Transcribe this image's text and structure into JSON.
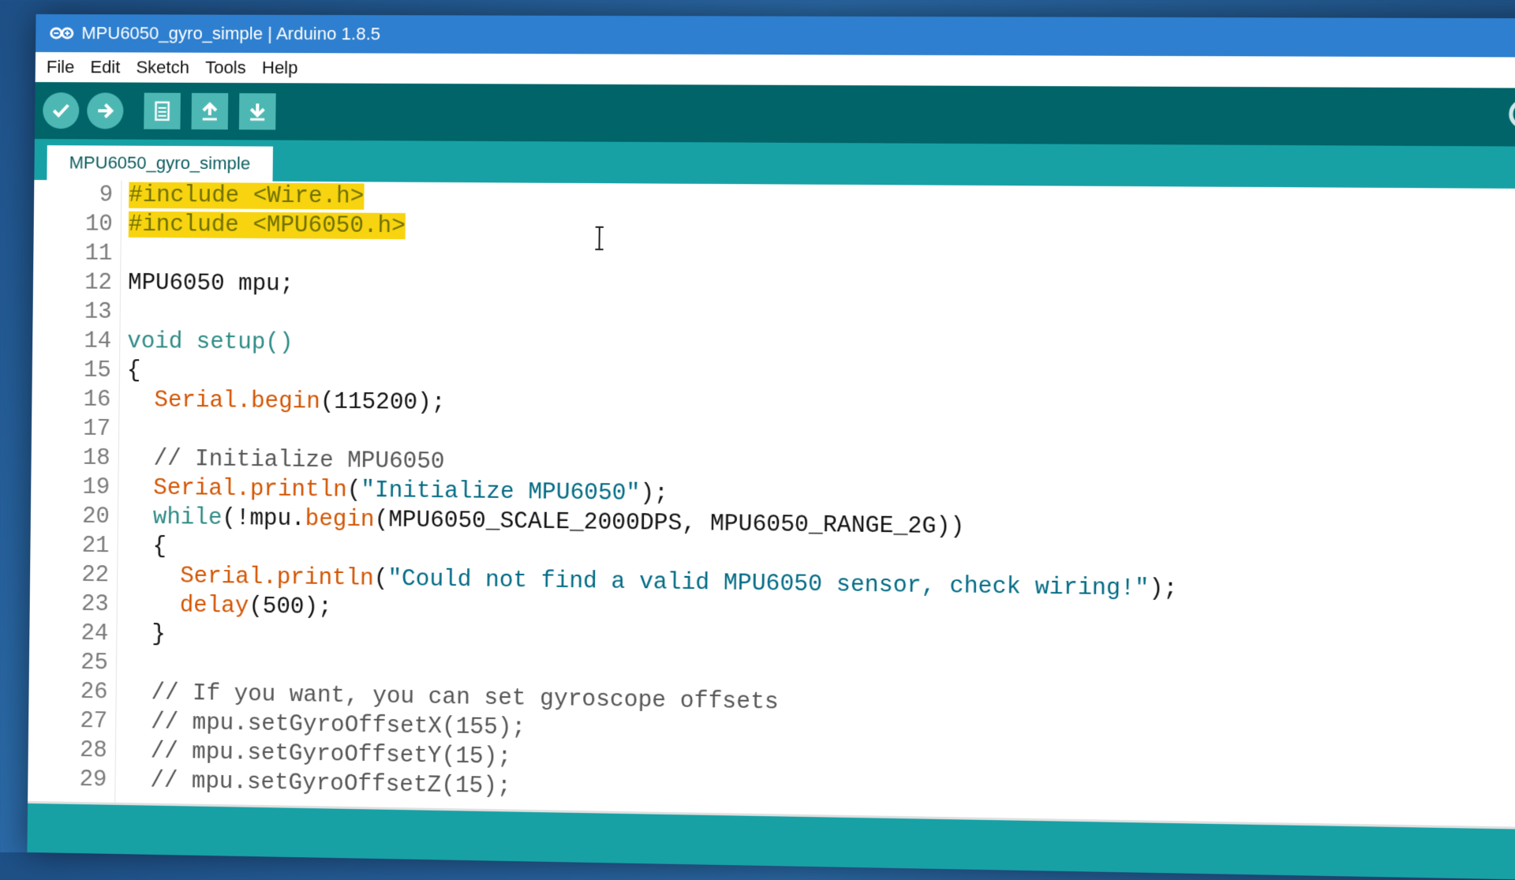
{
  "window": {
    "title": "MPU6050_gyro_simple | Arduino 1.8.5",
    "logo_icon": "arduino-infinity-icon"
  },
  "menu": {
    "items": [
      "File",
      "Edit",
      "Sketch",
      "Tools",
      "Help"
    ]
  },
  "toolbar": {
    "buttons": [
      {
        "name": "verify",
        "icon": "check-icon"
      },
      {
        "name": "upload",
        "icon": "arrow-right-icon"
      },
      {
        "name": "new",
        "icon": "new-document-icon"
      },
      {
        "name": "open",
        "icon": "arrow-up-icon"
      },
      {
        "name": "save",
        "icon": "arrow-down-icon"
      }
    ],
    "serial_monitor_icon": "magnifier-icon"
  },
  "tab": {
    "label": "MPU6050_gyro_simple"
  },
  "editor": {
    "lines": [
      {
        "n": "9",
        "segments": [
          {
            "t": "#include <Wire.h>",
            "c": "inc",
            "hl": true
          }
        ]
      },
      {
        "n": "10",
        "segments": [
          {
            "t": "#include <MPU6050.h>",
            "c": "inc",
            "hl": true
          }
        ]
      },
      {
        "n": "11",
        "segments": []
      },
      {
        "n": "12",
        "segments": [
          {
            "t": "MPU6050 mpu;",
            "c": ""
          }
        ]
      },
      {
        "n": "13",
        "segments": []
      },
      {
        "n": "14",
        "segments": [
          {
            "t": "void setup()",
            "c": "kw"
          }
        ]
      },
      {
        "n": "15",
        "segments": [
          {
            "t": "{",
            "c": ""
          }
        ]
      },
      {
        "n": "16",
        "segments": [
          {
            "t": "  ",
            "c": ""
          },
          {
            "t": "Serial.begin",
            "c": "fn"
          },
          {
            "t": "(115200);",
            "c": ""
          }
        ]
      },
      {
        "n": "17",
        "segments": []
      },
      {
        "n": "18",
        "segments": [
          {
            "t": "  // Initialize MPU6050",
            "c": "cm"
          }
        ]
      },
      {
        "n": "19",
        "segments": [
          {
            "t": "  ",
            "c": ""
          },
          {
            "t": "Serial.println",
            "c": "fn"
          },
          {
            "t": "(",
            "c": ""
          },
          {
            "t": "\"Initialize MPU6050\"",
            "c": "str"
          },
          {
            "t": ");",
            "c": ""
          }
        ]
      },
      {
        "n": "20",
        "segments": [
          {
            "t": "  ",
            "c": ""
          },
          {
            "t": "while",
            "c": "kw"
          },
          {
            "t": "(!mpu.",
            "c": ""
          },
          {
            "t": "begin",
            "c": "fn"
          },
          {
            "t": "(MPU6050_SCALE_2000DPS, MPU6050_RANGE_2G))",
            "c": ""
          }
        ]
      },
      {
        "n": "21",
        "segments": [
          {
            "t": "  {",
            "c": ""
          }
        ]
      },
      {
        "n": "22",
        "segments": [
          {
            "t": "    ",
            "c": ""
          },
          {
            "t": "Serial.println",
            "c": "fn"
          },
          {
            "t": "(",
            "c": ""
          },
          {
            "t": "\"Could not find a valid MPU6050 sensor, check wiring!\"",
            "c": "str"
          },
          {
            "t": ");",
            "c": ""
          }
        ]
      },
      {
        "n": "23",
        "segments": [
          {
            "t": "    ",
            "c": ""
          },
          {
            "t": "delay",
            "c": "fn"
          },
          {
            "t": "(500);",
            "c": ""
          }
        ]
      },
      {
        "n": "24",
        "segments": [
          {
            "t": "  }",
            "c": ""
          }
        ]
      },
      {
        "n": "25",
        "segments": []
      },
      {
        "n": "26",
        "segments": [
          {
            "t": "  // If you want, you can set gyroscope offsets",
            "c": "cm"
          }
        ]
      },
      {
        "n": "27",
        "segments": [
          {
            "t": "  // mpu.setGyroOffsetX(155);",
            "c": "cm"
          }
        ]
      },
      {
        "n": "28",
        "segments": [
          {
            "t": "  // mpu.setGyroOffsetY(15);",
            "c": "cm"
          }
        ]
      },
      {
        "n": "29",
        "segments": [
          {
            "t": "  // mpu.setGyroOffsetZ(15);",
            "c": "cm"
          }
        ]
      }
    ]
  },
  "colors": {
    "titlebar": "#2e7fcf",
    "toolbar": "#006468",
    "tabbar": "#17a1a5",
    "button": "#4db7b3",
    "highlight": "#f7d40f",
    "keyword": "#2c8a85",
    "function": "#d35400",
    "string": "#006a84"
  }
}
